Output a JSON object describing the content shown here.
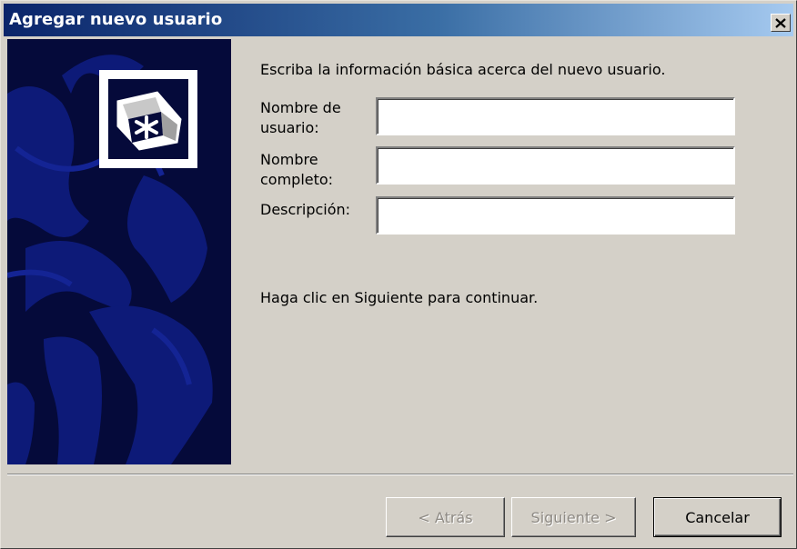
{
  "window": {
    "title": "Agregar nuevo usuario",
    "close_icon": "close-x-icon"
  },
  "banner": {
    "logo_icon": "asterisk-logo-icon"
  },
  "form": {
    "heading": "Escriba la información básica acerca del nuevo usuario.",
    "fields": [
      {
        "label_line1": "Nombre de",
        "label_line2": "usuario:",
        "value": ""
      },
      {
        "label_line1": "Nombre",
        "label_line2": "completo:",
        "value": ""
      },
      {
        "label_line1": "Descripción:",
        "value": ""
      }
    ],
    "hint": "Haga clic en Siguiente para continuar."
  },
  "buttons": {
    "back": "< Atrás",
    "next": "Siguiente >",
    "cancel": "Cancelar"
  },
  "colors": {
    "title_start": "#0a246a",
    "title_end": "#a6caf0",
    "banner_bg": "#050a3a",
    "dialog_bg": "#d4d0c8"
  }
}
